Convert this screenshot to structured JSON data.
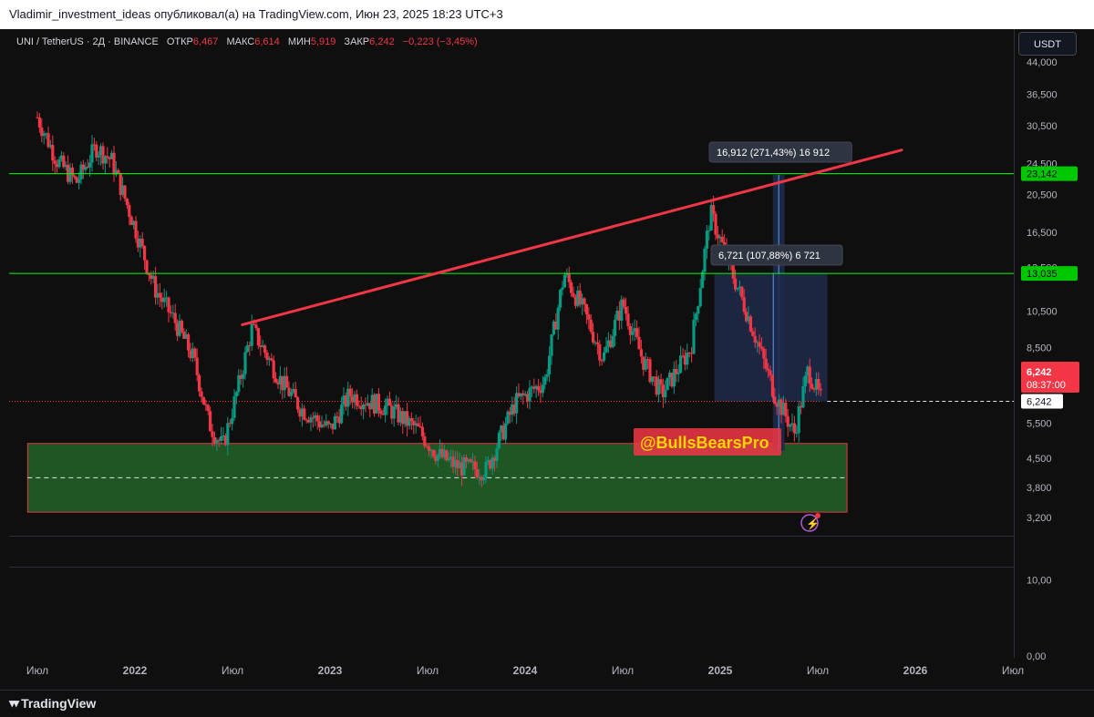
{
  "header": {
    "publisher_line": "Vladimir_investment_ideas опубликовал(а) на TradingView.com, Июн 23, 2025 18:23 UTC+3"
  },
  "symbol_bar": {
    "symbol": "UNI / TetherUS · 2Д · BINANCE",
    "open_label": "ОТКР",
    "open_value": "6,467",
    "high_label": "МАКС",
    "high_value": "6,614",
    "low_label": "МИН",
    "low_value": "5,919",
    "close_label": "ЗАКР",
    "close_value": "6,242",
    "change": "−0,223 (−3,45%)"
  },
  "currency_button": "USDT",
  "colors": {
    "background": "#0f0f0f",
    "candle_up": "#089981",
    "candle_down": "#f23645",
    "trendline": "#f23645",
    "level_line": "#00ff00",
    "zone_fill": "#1f5a26",
    "zone_border": "#f23645",
    "measure_fill": "#1e2a4a",
    "price_tag": "#f23645"
  },
  "price_axis": {
    "ticks": [
      "44,000",
      "36,500",
      "30,500",
      "24,500",
      "20,500",
      "16,500",
      "13,500",
      "10,500",
      "8,500",
      "5,500",
      "4,500",
      "3,800",
      "3,200"
    ]
  },
  "indicator_axis": {
    "ticks": [
      "10,00",
      "0,00"
    ]
  },
  "time_axis": {
    "ticks": [
      "Июл",
      "2022",
      "Июл",
      "2023",
      "Июл",
      "2024",
      "Июл",
      "2025",
      "Июл",
      "2026",
      "Июл"
    ]
  },
  "price_tags": {
    "level_high": "23,142",
    "level_mid": "13,035",
    "last_price": "6,242",
    "countdown": "08:37:00",
    "crosshair_price": "6,242"
  },
  "measurements": {
    "upper": "16,912 (271,43%) 16 912",
    "lower": "6,721 (107,88%) 6 721"
  },
  "watermark_badge": "@BullsBearsPro",
  "footer": {
    "brand": "TradingView"
  },
  "chart_data": {
    "type": "candlestick",
    "title": "UNI / TetherUS · 2Д · BINANCE",
    "scale": "log",
    "ylim": [
      3.0,
      46.0
    ],
    "x_ticks": [
      "Июл",
      "2022",
      "Июл",
      "2023",
      "Июл",
      "2024",
      "Июл",
      "2025",
      "Июл",
      "2026",
      "Июл"
    ],
    "y_ticks": [
      44.0,
      36.5,
      30.5,
      24.5,
      20.5,
      16.5,
      13.5,
      10.5,
      8.5,
      5.5,
      4.5,
      3.8,
      3.2
    ],
    "ohlc_last": {
      "open": 6.467,
      "high": 6.614,
      "low": 5.919,
      "close": 6.242,
      "change": -0.223,
      "change_pct": -3.45
    },
    "price_path": [
      {
        "t": 2021.5,
        "p": 32
      },
      {
        "t": 2021.6,
        "p": 25
      },
      {
        "t": 2021.7,
        "p": 22
      },
      {
        "t": 2021.8,
        "p": 27
      },
      {
        "t": 2021.88,
        "p": 25
      },
      {
        "t": 2022.0,
        "p": 17
      },
      {
        "t": 2022.1,
        "p": 12
      },
      {
        "t": 2022.2,
        "p": 10
      },
      {
        "t": 2022.3,
        "p": 8.0
      },
      {
        "t": 2022.38,
        "p": 5.5
      },
      {
        "t": 2022.45,
        "p": 4.8
      },
      {
        "t": 2022.52,
        "p": 6.5
      },
      {
        "t": 2022.6,
        "p": 9.5
      },
      {
        "t": 2022.75,
        "p": 7.0
      },
      {
        "t": 2022.85,
        "p": 6.0
      },
      {
        "t": 2023.0,
        "p": 5.3
      },
      {
        "t": 2023.1,
        "p": 6.5
      },
      {
        "t": 2023.3,
        "p": 6.0
      },
      {
        "t": 2023.45,
        "p": 5.3
      },
      {
        "t": 2023.55,
        "p": 4.6
      },
      {
        "t": 2023.65,
        "p": 4.3
      },
      {
        "t": 2023.8,
        "p": 4.2
      },
      {
        "t": 2023.95,
        "p": 6.2
      },
      {
        "t": 2024.1,
        "p": 7.0
      },
      {
        "t": 2024.2,
        "p": 13.0
      },
      {
        "t": 2024.3,
        "p": 10.5
      },
      {
        "t": 2024.4,
        "p": 8.0
      },
      {
        "t": 2024.5,
        "p": 11.0
      },
      {
        "t": 2024.6,
        "p": 8.0
      },
      {
        "t": 2024.7,
        "p": 6.5
      },
      {
        "t": 2024.85,
        "p": 8.5
      },
      {
        "t": 2024.95,
        "p": 18.5
      },
      {
        "t": 2025.05,
        "p": 13.5
      },
      {
        "t": 2025.15,
        "p": 10.0
      },
      {
        "t": 2025.28,
        "p": 6.5
      },
      {
        "t": 2025.38,
        "p": 5.2
      },
      {
        "t": 2025.45,
        "p": 7.5
      },
      {
        "t": 2025.52,
        "p": 6.242
      }
    ],
    "levels": [
      {
        "label": "23,142",
        "value": 23.142
      },
      {
        "label": "13,035",
        "value": 13.035
      }
    ],
    "trendline": {
      "from": {
        "t": 2022.55,
        "p": 9.7
      },
      "to": {
        "t": 2025.93,
        "p": 26.5
      }
    },
    "demand_zone": {
      "from_t": 2021.45,
      "to_t": 2025.65,
      "low": 3.3,
      "high": 4.9
    },
    "measures": [
      {
        "label": "16,912 (271,43%) 16 912",
        "from": 4.7,
        "to": 23.0
      },
      {
        "label": "6,721 (107,88%) 6 721",
        "from": 6.242,
        "to": 13.0
      }
    ]
  }
}
